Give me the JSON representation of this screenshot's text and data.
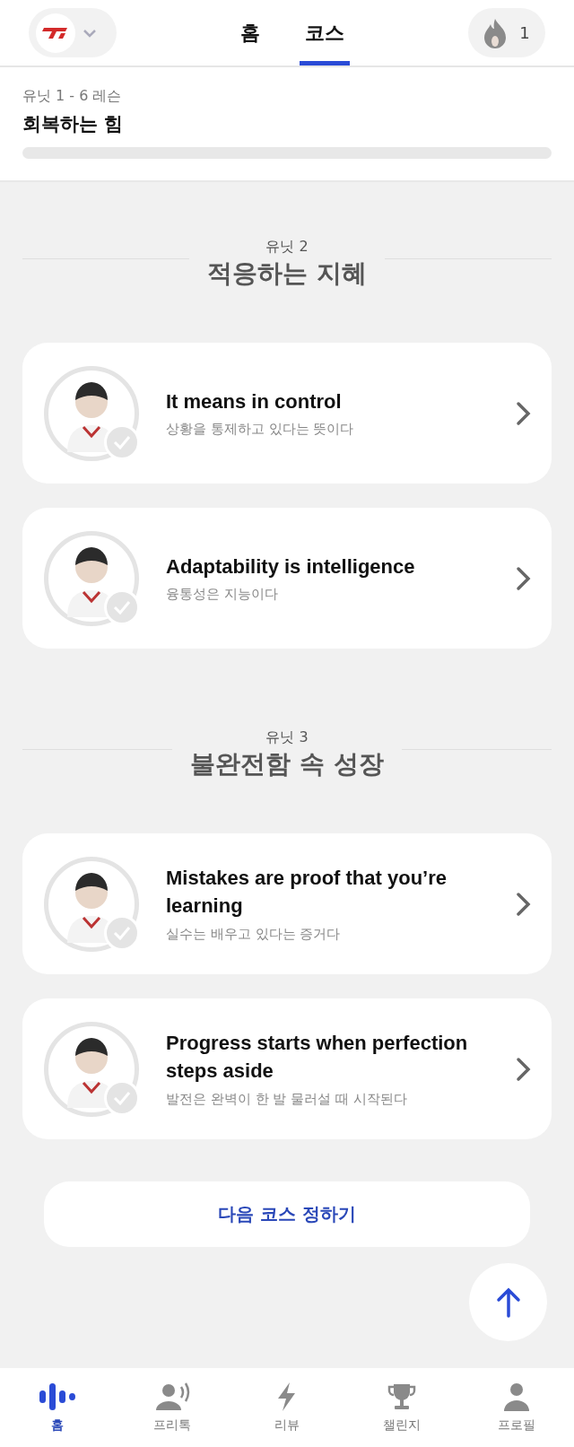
{
  "top_bar": {
    "tabs": [
      {
        "label": "홈",
        "selected": false
      },
      {
        "label": "코스",
        "selected": true
      }
    ],
    "streak": "1"
  },
  "course": {
    "caption": "유닛 1 - 6 레슨",
    "title": "회복하는 힘",
    "level": 0
  },
  "units": [
    {
      "label": "유닛 2",
      "title": "적응하는 지혜",
      "lessons": [
        {
          "title": "It means in control",
          "subtitle": "상황을 통제하고 있다는 뜻이다",
          "done": false
        },
        {
          "title": "Adaptability is intelligence",
          "subtitle": "융통성은 지능이다",
          "done": false
        }
      ]
    },
    {
      "label": "유닛 3",
      "title": "불완전함 속 성장",
      "lessons": [
        {
          "title": "Mistakes are proof that you’re learning",
          "subtitle": "실수는 배우고 있다는 증거다",
          "done": false
        },
        {
          "title": "Progress starts when perfection steps aside",
          "subtitle": "발전은 완벽이 한 발 물러설 때 시작된다",
          "done": false
        }
      ]
    }
  ],
  "next_course_button": "다음 코스 정하기",
  "bottom_nav": [
    {
      "label": "홈",
      "selected": true
    },
    {
      "label": "프리톡",
      "selected": false
    },
    {
      "label": "리뷰",
      "selected": false
    },
    {
      "label": "챌린지",
      "selected": false
    },
    {
      "label": "프로필",
      "selected": false
    }
  ]
}
